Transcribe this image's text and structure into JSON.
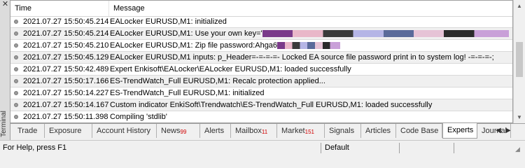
{
  "sidebar": {
    "title": "Terminal",
    "close_glyph": "✕"
  },
  "log": {
    "columns": {
      "time": "Time",
      "message": "Message"
    },
    "rows": [
      {
        "time": "2021.07.27 15:50:45.214",
        "message": "EALocker EURUSD,M1: initialized",
        "redacted": false
      },
      {
        "time": "2021.07.27 15:50:45.214",
        "message": "EALocker EURUSD,M1: Use your own key='",
        "redacted": true,
        "redacted_tail": "'"
      },
      {
        "time": "2021.07.27 15:50:45.210",
        "message": "EALocker EURUSD,M1: Zip file password:Ahga6",
        "redacted": true,
        "redacted_tail": ""
      },
      {
        "time": "2021.07.27 15:50:45.129",
        "message": "EALocker EURUSD,M1 inputs: p_Header=-=-=-=- Locked EA source file password print in to system log! -=-=-=-;",
        "redacted": false
      },
      {
        "time": "2021.07.27 15:50:42.489",
        "message": "Expert Enkisoft\\EALocker\\EALocker EURUSD,M1: loaded successfully",
        "redacted": false
      },
      {
        "time": "2021.07.27 15:50:17.166",
        "message": "ES-TrendWatch_Full EURUSD,M1: Recalc protection applied...",
        "redacted": false
      },
      {
        "time": "2021.07.27 15:50:14.227",
        "message": "ES-TrendWatch_Full EURUSD,M1: initialized",
        "redacted": false
      },
      {
        "time": "2021.07.27 15:50:14.167",
        "message": "Custom indicator EnkiSoft\\Trendwatch\\ES-TrendWatch_Full EURUSD,M1: loaded successfully",
        "redacted": false
      },
      {
        "time": "2021.07.27 15:50:11.398",
        "message": "Compiling 'stdlib'",
        "redacted": false
      }
    ]
  },
  "tabs": [
    {
      "label": "Trade",
      "badge": ""
    },
    {
      "label": "Exposure",
      "badge": ""
    },
    {
      "label": "Account History",
      "badge": ""
    },
    {
      "label": "News",
      "badge": "99"
    },
    {
      "label": "Alerts",
      "badge": ""
    },
    {
      "label": "Mailbox",
      "badge": "11"
    },
    {
      "label": "Market",
      "badge": "151"
    },
    {
      "label": "Signals",
      "badge": ""
    },
    {
      "label": "Articles",
      "badge": ""
    },
    {
      "label": "Code Base",
      "badge": ""
    },
    {
      "label": "Experts",
      "badge": "",
      "active": true
    },
    {
      "label": "Journal",
      "badge": ""
    }
  ],
  "status": {
    "help": "For Help, press F1",
    "profile": "Default"
  },
  "colors": {
    "badge": "#d00000",
    "row_alt": "#f0f0f0"
  }
}
